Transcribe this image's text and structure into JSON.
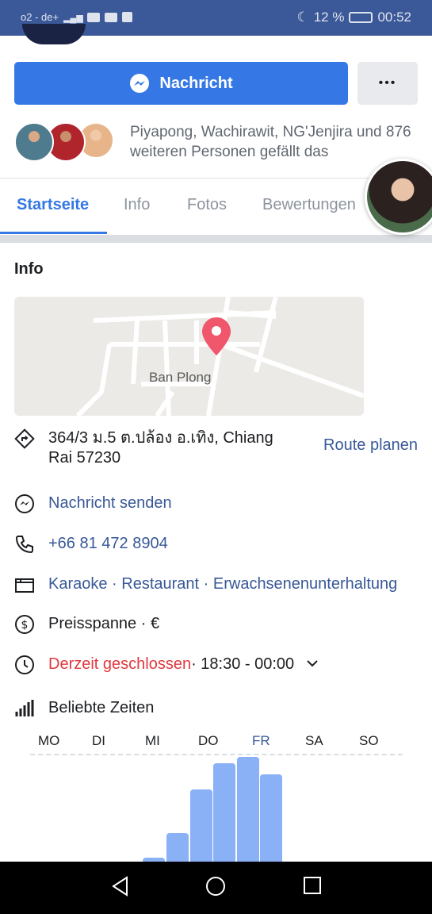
{
  "status_bar": {
    "carrier": "o2 - de+",
    "battery": "12 %",
    "time": "00:52",
    "icons": [
      "signal-icon",
      "youtube-icon",
      "activity-icon",
      "facebook-icon",
      "moon-icon",
      "battery-icon"
    ]
  },
  "actions": {
    "message_label": "Nachricht",
    "more_label": "•••"
  },
  "likes": {
    "text": "Piyapong, Wachirawit, NG'Jenjira und 876 weiteren Personen gefällt das"
  },
  "tabs": [
    {
      "label": "Startseite",
      "active": true
    },
    {
      "label": "Info",
      "active": false
    },
    {
      "label": "Fotos",
      "active": false
    },
    {
      "label": "Bewertungen",
      "active": false
    }
  ],
  "info": {
    "title": "Info",
    "map_label": "Ban Plong",
    "address": "364/3 ม.5 ต.ปล้อง อ.เทิง, Chiang Rai 57230",
    "route_label": "Route planen",
    "message_label": "Nachricht senden",
    "phone": "+66 81 472 8904",
    "categories": "Karaoke · Restaurant · Erwachsenenunterhaltung",
    "price_label": "Preisspanne · €",
    "hours_status": "Derzeit geschlossen",
    "hours_time": " · 18:30 - 00:00",
    "popular_title": "Beliebte Zeiten"
  },
  "colors": {
    "brand": "#3b5998",
    "accent": "#3578e5",
    "link": "#385898",
    "closed": "#e0393e",
    "bar": "#8ab0f5"
  },
  "chart_data": {
    "type": "bar",
    "categories": [
      "MO",
      "DI",
      "MI",
      "DO",
      "FR",
      "SA",
      "SO"
    ],
    "highlight": "FR",
    "values": [
      0,
      0,
      0,
      0,
      5,
      35,
      90,
      122,
      130,
      108
    ],
    "ylim": [
      0,
      130
    ]
  }
}
